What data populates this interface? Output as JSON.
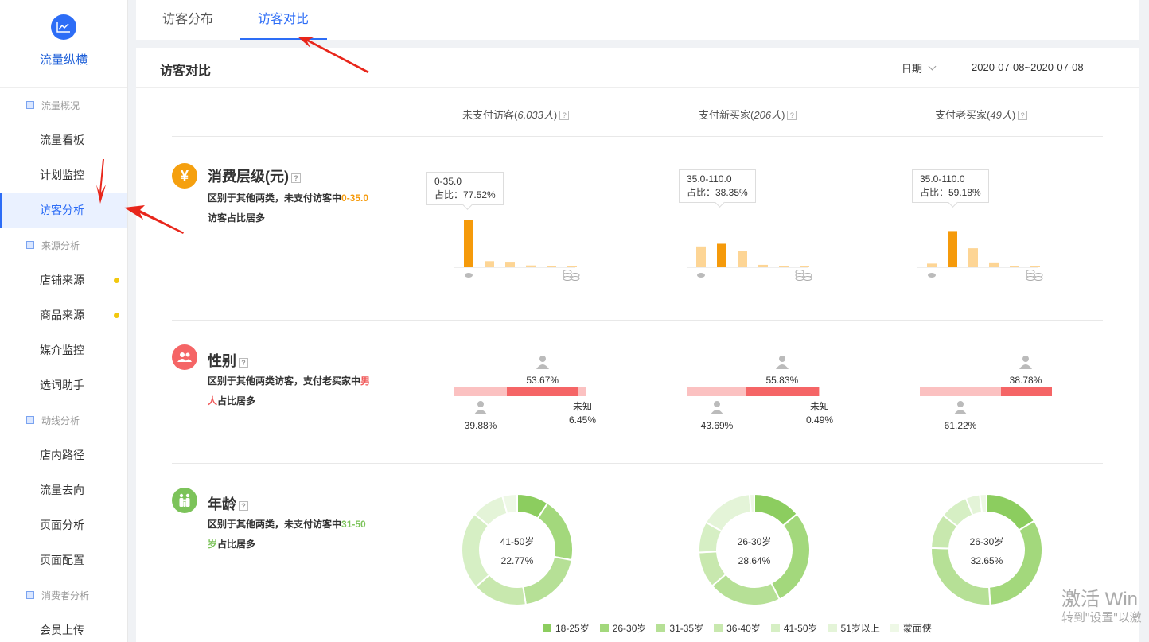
{
  "app": {
    "title": "流量纵横"
  },
  "sidebar": [
    {
      "type": "group",
      "label": "流量概况"
    },
    {
      "type": "item",
      "label": "流量看板"
    },
    {
      "type": "item",
      "label": "计划监控"
    },
    {
      "type": "item",
      "label": "访客分析",
      "active": true
    },
    {
      "type": "group",
      "label": "来源分析"
    },
    {
      "type": "item",
      "label": "店铺来源",
      "dot": true
    },
    {
      "type": "item",
      "label": "商品来源",
      "dot": true
    },
    {
      "type": "item",
      "label": "媒介监控"
    },
    {
      "type": "item",
      "label": "选词助手"
    },
    {
      "type": "group",
      "label": "动线分析"
    },
    {
      "type": "item",
      "label": "店内路径"
    },
    {
      "type": "item",
      "label": "流量去向"
    },
    {
      "type": "item",
      "label": "页面分析"
    },
    {
      "type": "item",
      "label": "页面配置"
    },
    {
      "type": "group",
      "label": "消费者分析"
    },
    {
      "type": "item",
      "label": "会员上传"
    }
  ],
  "tabs": [
    {
      "label": "访客分布",
      "active": false
    },
    {
      "label": "访客对比",
      "active": true
    }
  ],
  "main": {
    "title": "访客对比",
    "date_label": "日期",
    "date_range": "2020-07-08~2020-07-08",
    "columns": [
      {
        "name": "未支付访客",
        "count": "6,033人"
      },
      {
        "name": "支付新买家",
        "count": "206人"
      },
      {
        "name": "支付老买家",
        "count": "49人"
      }
    ]
  },
  "sections": {
    "spending": {
      "title": "消费层级(元)",
      "desc_pre": "区别于其他两类，未支付访客中",
      "desc_hl": "0-35.0",
      "desc_post": "访客占比居多",
      "hl_color": "#f59a0b",
      "charts": [
        {
          "tooltip_range": "0-35.0",
          "tooltip_share": "占比：77.52%",
          "bars": [
            0.7752,
            0.1,
            0.09,
            0.03,
            0.01,
            0.01
          ],
          "highlight": 0
        },
        {
          "tooltip_range": "35.0-110.0",
          "tooltip_share": "占比：38.35%",
          "bars": [
            0.34,
            0.3835,
            0.26,
            0.04,
            0.015,
            0.015
          ],
          "highlight": 1
        },
        {
          "tooltip_range": "35.0-110.0",
          "tooltip_share": "占比：59.18%",
          "bars": [
            0.06,
            0.5918,
            0.31,
            0.08,
            0.02,
            0.02
          ],
          "highlight": 1
        }
      ]
    },
    "gender": {
      "title": "性别",
      "desc_pre": "区别于其他两类访客，支付老买家中",
      "desc_hl": "男人",
      "desc_post": "占比居多",
      "hl_color": "#f05a5a",
      "unknown_label": "未知",
      "charts": [
        {
          "female": "39.88%",
          "male": "53.67%",
          "unknown": "6.45%",
          "f": 0.3988,
          "m": 0.5367,
          "u": 0.0645
        },
        {
          "female": "43.69%",
          "male": "55.83%",
          "unknown": "0.49%",
          "f": 0.4369,
          "m": 0.5583,
          "u": 0.0049
        },
        {
          "female": "61.22%",
          "male": "38.78%",
          "f": 0.6122,
          "m": 0.3878,
          "u": 0
        }
      ]
    },
    "age": {
      "title": "年龄",
      "desc_pre": "区别于其他两类，未支付访客中",
      "desc_hl": "31-50岁",
      "desc_post": "占比居多",
      "hl_color": "#7cc35a",
      "charts": [
        {
          "center_label": "41-50岁",
          "center_value": "22.77%",
          "values": [
            9.2,
            18.8,
            19.5,
            15.8,
            22.77,
            9.6,
            4.3
          ]
        },
        {
          "center_label": "26-30岁",
          "center_value": "28.64%",
          "values": [
            13.9,
            28.64,
            21.2,
            10.5,
            9.0,
            15.4,
            1.4
          ]
        },
        {
          "center_label": "26-30岁",
          "center_value": "32.65%",
          "values": [
            16.33,
            32.65,
            26.5,
            10.2,
            8.2,
            4.1,
            2.0
          ]
        }
      ],
      "legend": [
        "18-25岁",
        "26-30岁",
        "31-35岁",
        "36-40岁",
        "41-50岁",
        "51岁以上",
        "蒙面侠"
      ],
      "colors": [
        "#8ccd5f",
        "#a3d87c",
        "#b6e096",
        "#c8e8ae",
        "#d6efc4",
        "#e4f4d8",
        "#eef8e6"
      ]
    }
  },
  "colors": {
    "accent": "#2d6df6",
    "orange": "#f59a0b",
    "orange_light": "#fdd595",
    "red": "#f56566",
    "pink": "#fbc1c1"
  },
  "watermark": {
    "line1": "激活 Win",
    "line2": "转到\"设置\"以激"
  }
}
